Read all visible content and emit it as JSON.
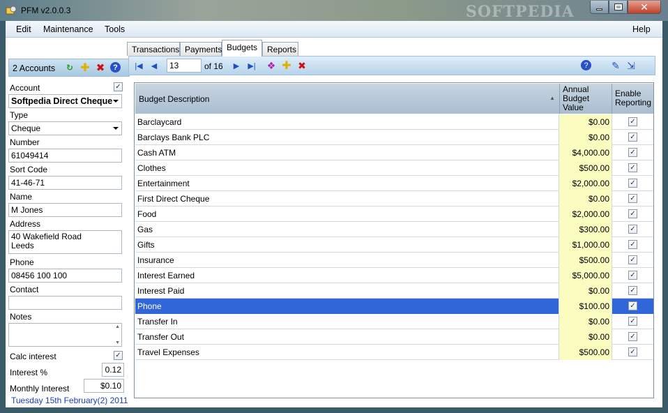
{
  "window": {
    "title": "PFM v2.0.0.3",
    "watermark": "SOFTPEDIA"
  },
  "menu": {
    "edit": "Edit",
    "maintenance": "Maintenance",
    "tools": "Tools",
    "help": "Help"
  },
  "left": {
    "accounts_label": "2 Accounts",
    "account_label": "Account",
    "account_value": "Softpedia Direct Cheque",
    "type_label": "Type",
    "type_value": "Cheque",
    "number_label": "Number",
    "number_value": "61049414",
    "sortcode_label": "Sort Code",
    "sortcode_value": "41-46-71",
    "name_label": "Name",
    "name_value": "M Jones",
    "address_label": "Address",
    "address_line1": "40 Wakefield Road",
    "address_line2": "Leeds",
    "phone_label": "Phone",
    "phone_value": "08456 100 100",
    "contact_label": "Contact",
    "contact_value": "",
    "notes_label": "Notes",
    "calc_label": "Calc interest",
    "interest_label": "Interest %",
    "interest_value": "0.12",
    "monthly_label": "Monthly Interest",
    "monthly_value": "$0.10",
    "date": "Tuesday 15th February(2) 2011"
  },
  "tabs": [
    "Transactions",
    "Payments",
    "Budgets",
    "Reports"
  ],
  "nav": {
    "current": "13",
    "of": "of 16"
  },
  "grid": {
    "col_desc": "Budget Description",
    "col_val": [
      "Annual",
      "Budget",
      "Value"
    ],
    "col_chk": [
      "Enable",
      "Reporting"
    ],
    "rows": [
      {
        "desc": "Barclaycard",
        "val": "$0.00"
      },
      {
        "desc": "Barclays Bank PLC",
        "val": "$0.00"
      },
      {
        "desc": "Cash ATM",
        "val": "$4,000.00"
      },
      {
        "desc": "Clothes",
        "val": "$500.00"
      },
      {
        "desc": "Entertainment",
        "val": "$2,000.00"
      },
      {
        "desc": "First Direct Cheque",
        "val": "$0.00"
      },
      {
        "desc": "Food",
        "val": "$2,000.00"
      },
      {
        "desc": "Gas",
        "val": "$300.00"
      },
      {
        "desc": "Gifts",
        "val": "$1,000.00"
      },
      {
        "desc": "Insurance",
        "val": "$500.00"
      },
      {
        "desc": "Interest Earned",
        "val": "$5,000.00"
      },
      {
        "desc": "Interest Paid",
        "val": "$0.00"
      },
      {
        "desc": "Phone",
        "val": "$100.00"
      },
      {
        "desc": "Transfer In",
        "val": "$0.00"
      },
      {
        "desc": "Transfer Out",
        "val": "$0.00"
      },
      {
        "desc": "Travel Expenses",
        "val": "$500.00"
      }
    ]
  }
}
